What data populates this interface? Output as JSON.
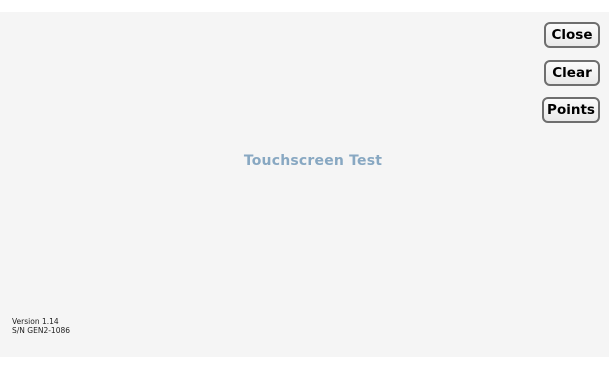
{
  "app": {
    "title": "Touchscreen Test"
  },
  "toolbar": {
    "close_label": "Close",
    "clear_label": "Clear",
    "points_label": "Points"
  },
  "footer": {
    "version": "Version 1.14",
    "serial": "S/N GEN2-1086"
  },
  "colors": {
    "background": "#f5f5f5",
    "title": "#88a8c2",
    "button_border": "#6e6e6e"
  }
}
